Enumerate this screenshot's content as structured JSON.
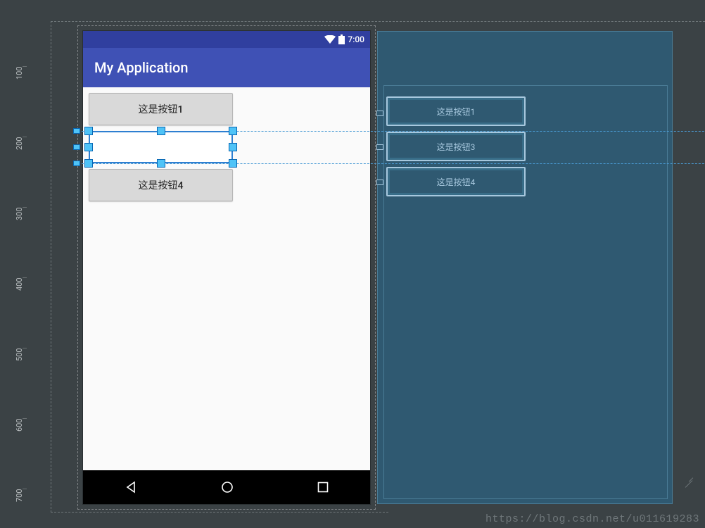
{
  "ruler": {
    "v": [
      "100",
      "200",
      "300",
      "400",
      "500",
      "600",
      "700"
    ]
  },
  "status": {
    "time": "7:00"
  },
  "app": {
    "title": "My Application"
  },
  "buttons": {
    "b1": "这是按钮1",
    "b3": "",
    "b4": "这是按钮4"
  },
  "blueprint": {
    "b1": "这是按钮1",
    "b3": "这是按钮3",
    "b4": "这是按钮4"
  },
  "watermark": "https://blog.csdn.net/u011619283"
}
